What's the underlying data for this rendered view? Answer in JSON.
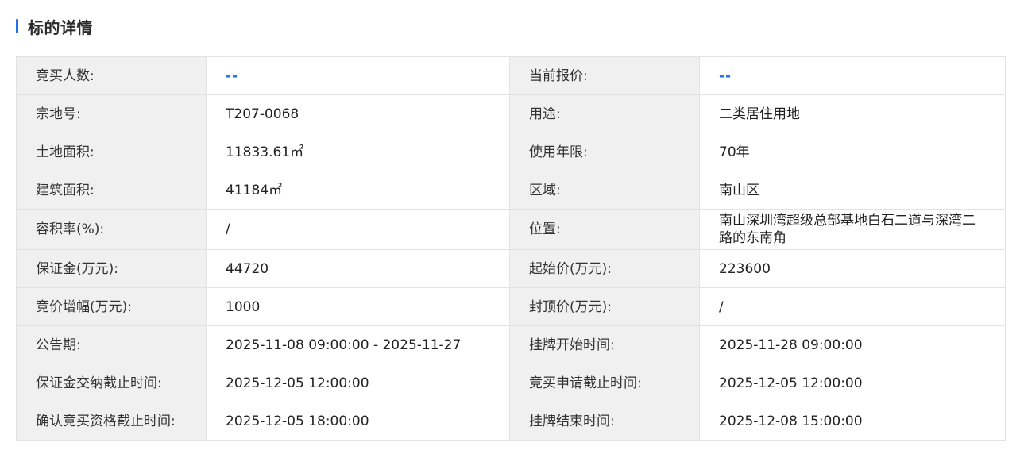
{
  "section": {
    "title": "标的详情",
    "accent_color": "#1f6fe5"
  },
  "rows": [
    {
      "left_label": "竞买人数:",
      "left_value": "--",
      "right_label": "当前报价:",
      "right_value": "--"
    },
    {
      "left_label": "宗地号:",
      "left_value": "T207-0068",
      "right_label": "用途:",
      "right_value": "二类居住用地"
    },
    {
      "left_label": "土地面积:",
      "left_value": "11833.61㎡",
      "right_label": "使用年限:",
      "right_value": "70年"
    },
    {
      "left_label": "建筑面积:",
      "left_value": "41184㎡",
      "right_label": "区域:",
      "right_value": "南山区"
    },
    {
      "left_label": "容积率(%):",
      "left_value": "/",
      "right_label": "位置:",
      "right_value": "南山深圳湾超级总部基地白石二道与深湾二路的东南角"
    },
    {
      "left_label": "保证金(万元):",
      "left_value": "44720",
      "right_label": "起始价(万元):",
      "right_value": "223600"
    },
    {
      "left_label": "竞价增幅(万元):",
      "left_value": "1000",
      "right_label": "封顶价(万元):",
      "right_value": "/"
    },
    {
      "left_label": "公告期:",
      "left_value": "2025-11-08 09:00:00 - 2025-11-27",
      "right_label": "挂牌开始时间:",
      "right_value": "2025-11-28 09:00:00"
    },
    {
      "left_label": "保证金交纳截止时间:",
      "left_value": "2025-12-05 12:00:00",
      "right_label": "竞买申请截止时间:",
      "right_value": "2025-12-05 12:00:00"
    },
    {
      "left_label": "确认竞买资格截止时间:",
      "left_value": "2025-12-05 18:00:00",
      "right_label": "挂牌结束时间:",
      "right_value": "2025-12-08 15:00:00"
    }
  ]
}
